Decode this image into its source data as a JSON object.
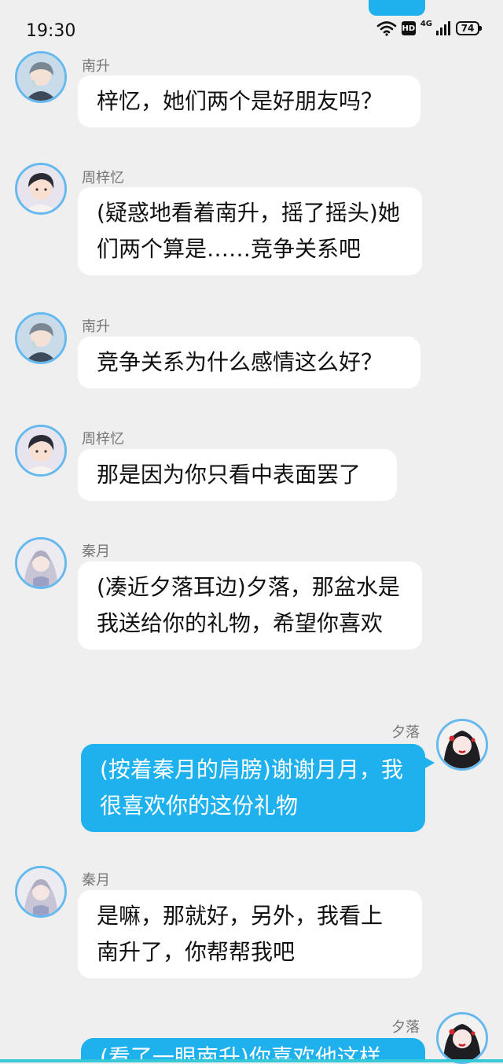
{
  "status_bar": {
    "time": "19:30",
    "hd": "HD",
    "network": "4G",
    "battery": "74"
  },
  "messages": [
    {
      "sender": "南升",
      "text": "梓忆，她们两个是好朋友吗？",
      "avatar": "boy-gray-hair-avatar",
      "outgoing": false
    },
    {
      "sender": "周梓忆",
      "text": "(疑惑地看着南升，摇了摇头)她们两个算是……竞争关系吧",
      "avatar": "boy-dark-hair-avatar",
      "outgoing": false
    },
    {
      "sender": "南升",
      "text": "竞争关系为什么感情这么好？",
      "avatar": "boy-gray-hair-avatar",
      "outgoing": false
    },
    {
      "sender": "周梓忆",
      "text": "那是因为你只看中表面罢了",
      "avatar": "boy-dark-hair-avatar",
      "outgoing": false
    },
    {
      "sender": "秦月",
      "text": "(凑近夕落耳边)夕落，那盆水是我送给你的礼物，希望你喜欢",
      "avatar": "girl-silver-hair-avatar",
      "outgoing": false
    },
    {
      "sender": "夕落",
      "text": "(按着秦月的肩膀)谢谢月月，我很喜欢你的这份礼物",
      "avatar": "girl-red-lips-avatar",
      "outgoing": true
    },
    {
      "sender": "秦月",
      "text": "是嘛，那就好，另外，我看上南升了，你帮帮我吧",
      "avatar": "girl-silver-hair-avatar",
      "outgoing": false
    },
    {
      "sender": "夕落",
      "text": "(看了一眼南升)你喜欢他这样",
      "avatar": "girl-red-lips-avatar",
      "outgoing": true
    }
  ],
  "colors": {
    "background": "#efefef",
    "outgoing_bubble": "#1fb1ee",
    "incoming_bubble": "#ffffff",
    "avatar_ring": "#66b9ee"
  }
}
